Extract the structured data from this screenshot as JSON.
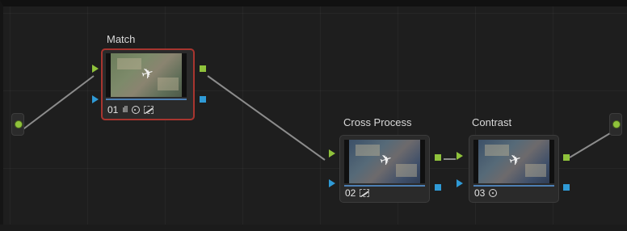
{
  "nodes": [
    {
      "title": "Match",
      "number": "01",
      "icons": [
        "bars-icon",
        "circle-icon",
        "curve-icon"
      ],
      "selected": true
    },
    {
      "title": "Cross Process",
      "number": "02",
      "icons": [
        "curve-icon"
      ],
      "selected": false
    },
    {
      "title": "Contrast",
      "number": "03",
      "icons": [
        "circle-icon"
      ],
      "selected": false
    }
  ],
  "colors": {
    "rgb_port": "#8fc23b",
    "alpha_port": "#2f9ad6",
    "selected_border": "#a8352f",
    "wire": "#8c8c8c"
  },
  "icon_glyphs": {
    "bars": "ıll",
    "plane": "✈"
  }
}
